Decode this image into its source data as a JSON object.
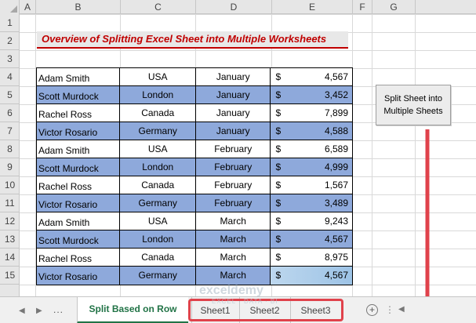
{
  "columns": [
    "A",
    "B",
    "C",
    "D",
    "E",
    "F",
    "G"
  ],
  "rows": [
    "1",
    "2",
    "3",
    "4",
    "5",
    "6",
    "7",
    "8",
    "9",
    "10",
    "11",
    "12",
    "13",
    "14",
    "15"
  ],
  "title": "Overview of Splitting Excel Sheet into Multiple Worksheets",
  "table": [
    {
      "name": "Adam Smith",
      "region": "USA",
      "month": "January",
      "currency": "$",
      "amount": "4,567"
    },
    {
      "name": "Scott Murdock",
      "region": "London",
      "month": "January",
      "currency": "$",
      "amount": "3,452"
    },
    {
      "name": "Rachel Ross",
      "region": "Canada",
      "month": "January",
      "currency": "$",
      "amount": "7,899"
    },
    {
      "name": "Victor Rosario",
      "region": "Germany",
      "month": "January",
      "currency": "$",
      "amount": "4,588"
    },
    {
      "name": "Adam Smith",
      "region": "USA",
      "month": "February",
      "currency": "$",
      "amount": "6,589"
    },
    {
      "name": "Scott Murdock",
      "region": "London",
      "month": "February",
      "currency": "$",
      "amount": "4,999"
    },
    {
      "name": "Rachel Ross",
      "region": "Canada",
      "month": "February",
      "currency": "$",
      "amount": "1,567"
    },
    {
      "name": "Victor Rosario",
      "region": "Germany",
      "month": "February",
      "currency": "$",
      "amount": "3,489"
    },
    {
      "name": "Adam Smith",
      "region": "USA",
      "month": "March",
      "currency": "$",
      "amount": "9,243"
    },
    {
      "name": "Scott Murdock",
      "region": "London",
      "month": "March",
      "currency": "$",
      "amount": "4,567"
    },
    {
      "name": "Rachel Ross",
      "region": "Canada",
      "month": "March",
      "currency": "$",
      "amount": "8,975"
    },
    {
      "name": "Victor Rosario",
      "region": "Germany",
      "month": "March",
      "currency": "$",
      "amount": "4,567"
    }
  ],
  "button": {
    "line1": "Split Sheet into",
    "line2": "Multiple Sheets"
  },
  "tabs": {
    "ellipsis": "...",
    "active": "Split Based on Row",
    "sheets": [
      "Sheet1",
      "Sheet2",
      "Sheet3"
    ],
    "add": "+"
  },
  "watermark": {
    "brand": "exceldemy",
    "tagline": "EXCEL · DATA · BI"
  },
  "colors": {
    "accent_red": "#e0424b",
    "title_red": "#c00000",
    "row_band": "#8ea9db",
    "excel_green": "#217346"
  },
  "icons": {
    "prev": "triangle-left-icon",
    "next": "triangle-right-icon",
    "add_sheet": "plus-circle-icon"
  }
}
